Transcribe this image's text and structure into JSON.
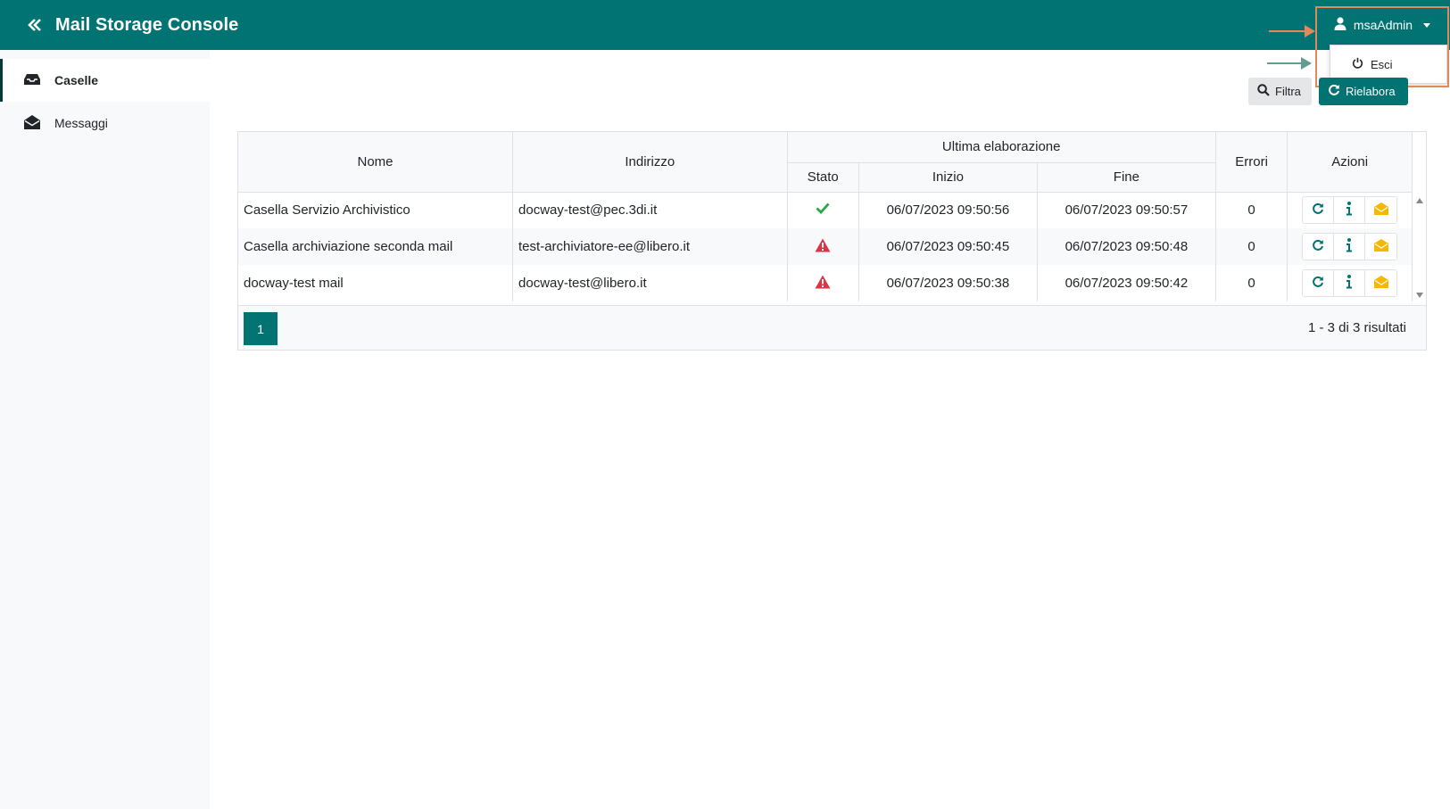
{
  "header": {
    "app_title": "Mail Storage Console",
    "collapse_icon": "double-chevron-left-icon",
    "user_name": "msaAdmin",
    "user_menu": {
      "logout_label": "Esci"
    }
  },
  "sidebar": {
    "items": [
      {
        "label": "Caselle",
        "icon": "inbox-icon",
        "active": true
      },
      {
        "label": "Messaggi",
        "icon": "envelope-open-icon",
        "active": false
      }
    ]
  },
  "toolbar": {
    "filter_label": "Filtra",
    "reprocess_label": "Rielabora"
  },
  "table": {
    "headers": {
      "nome": "Nome",
      "indirizzo": "Indirizzo",
      "ultima_elaborazione": "Ultima elaborazione",
      "stato": "Stato",
      "inizio": "Inizio",
      "fine": "Fine",
      "errori": "Errori",
      "azioni": "Azioni"
    },
    "rows": [
      {
        "nome": "Casella Servizio Archivistico",
        "indirizzo": "docway-test@pec.3di.it",
        "stato": "ok",
        "inizio": "06/07/2023 09:50:56",
        "fine": "06/07/2023 09:50:57",
        "errori": "0"
      },
      {
        "nome": "Casella archiviazione seconda mail",
        "indirizzo": "test-archiviatore-ee@libero.it",
        "stato": "warning",
        "inizio": "06/07/2023 09:50:45",
        "fine": "06/07/2023 09:50:48",
        "errori": "0"
      },
      {
        "nome": "docway-test mail",
        "indirizzo": "docway-test@libero.it",
        "stato": "warning",
        "inizio": "06/07/2023 09:50:38",
        "fine": "06/07/2023 09:50:42",
        "errori": "0"
      }
    ]
  },
  "pagination": {
    "current_page": "1",
    "results_text": "1 - 3 di 3 risultati"
  },
  "colors": {
    "primary": "#017373",
    "success": "#28a745",
    "danger": "#dc3545",
    "warning": "#f5b700",
    "annotation_orange": "#e1895a",
    "annotation_green": "#5f9e90"
  }
}
